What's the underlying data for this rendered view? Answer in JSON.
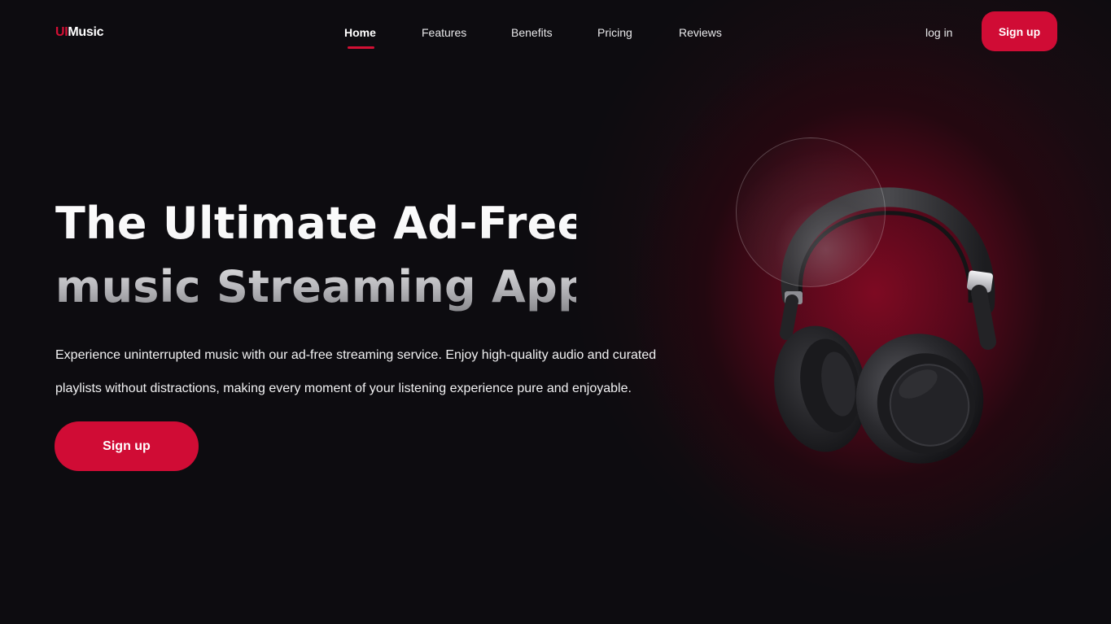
{
  "brand": {
    "prefix": "UI",
    "name": "Music"
  },
  "nav": {
    "items": [
      {
        "label": "Home",
        "active": true
      },
      {
        "label": "Features",
        "active": false
      },
      {
        "label": "Benefits",
        "active": false
      },
      {
        "label": "Pricing",
        "active": false
      },
      {
        "label": "Reviews",
        "active": false
      }
    ]
  },
  "header": {
    "login_label": "log in",
    "signup_label": "Sign up"
  },
  "hero": {
    "title_line1": "The Ultimate Ad-Free",
    "title_line2": "music Streaming App",
    "description": "Experience uninterrupted music with our ad-free streaming service. Enjoy high-quality audio and curated playlists without distractions, making every moment of your listening experience pure and enjoyable.",
    "cta_label": "Sign up"
  },
  "theme": {
    "accent": "#d00c35",
    "background": "#0d0c10",
    "glow": "#7a0a22"
  },
  "visual": {
    "image": "headphones-image",
    "decoration": "glass-circle"
  }
}
